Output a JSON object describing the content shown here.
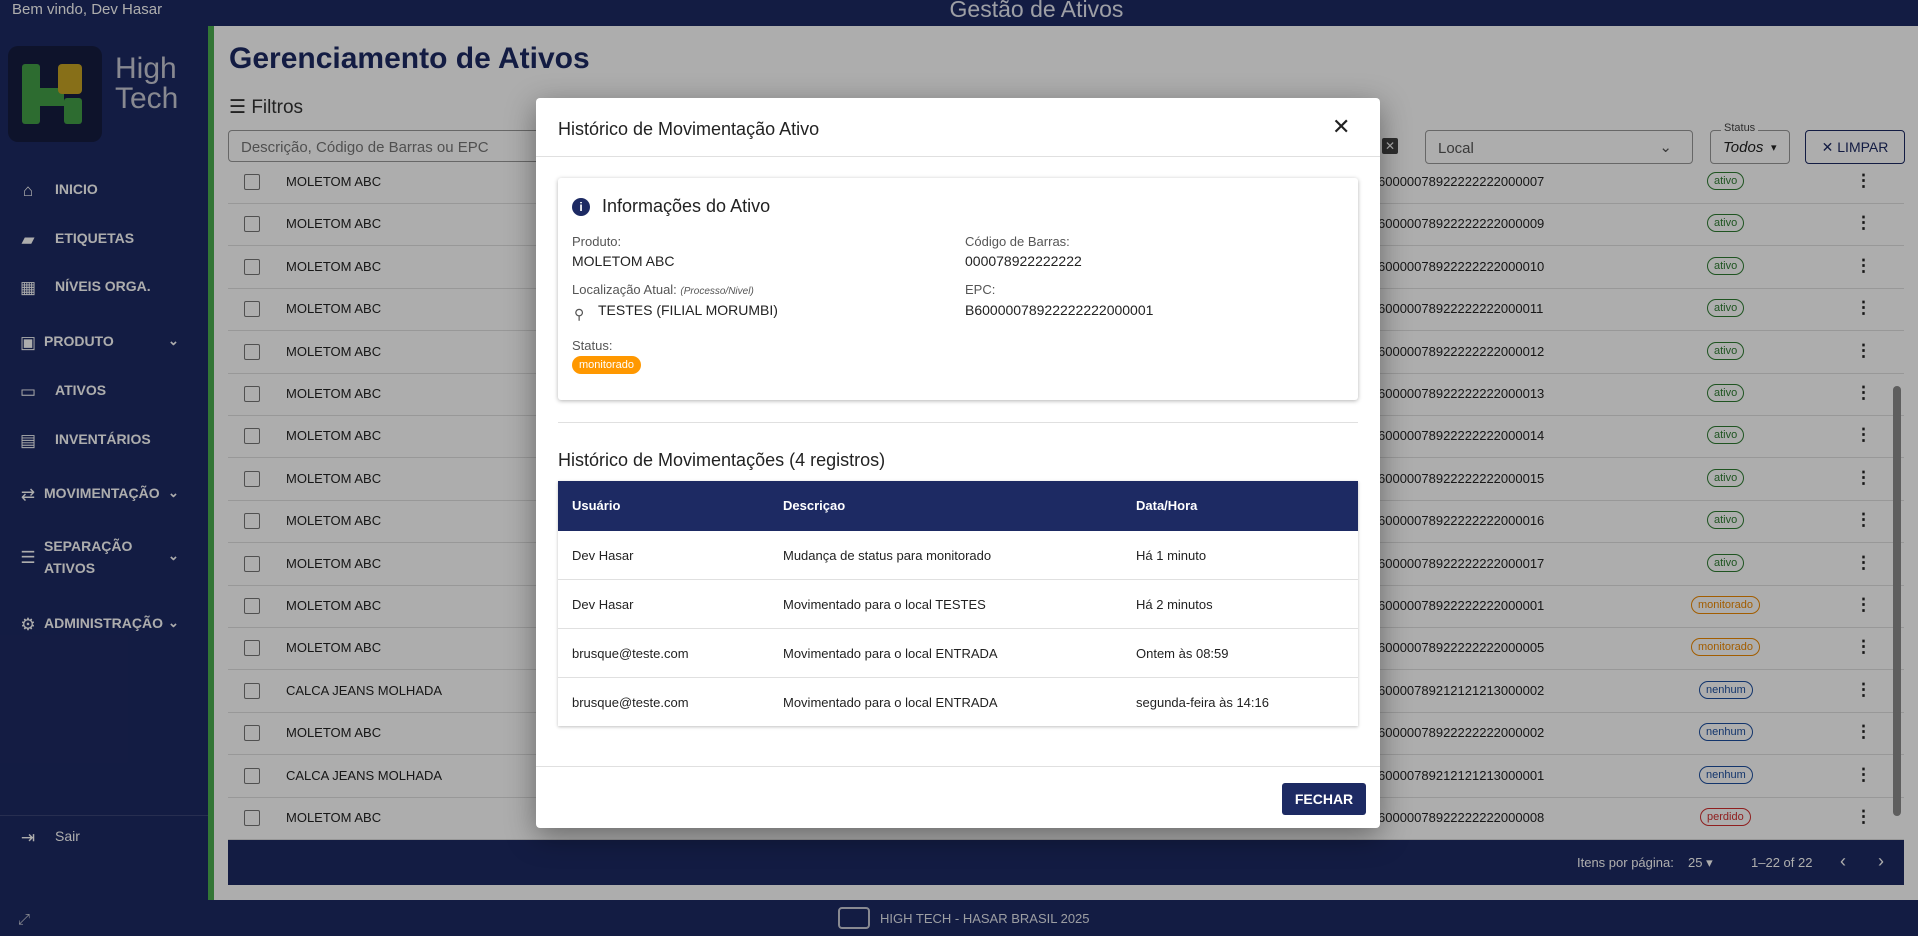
{
  "header": {
    "welcome": "Bem vindo, Dev Hasar",
    "app_title": "Gestão de Ativos"
  },
  "sidebar": {
    "logo_text_1": "High",
    "logo_text_2": "Tech",
    "items": [
      {
        "label": "INICIO",
        "icon": "home-icon"
      },
      {
        "label": "ETIQUETAS",
        "icon": "label-icon"
      },
      {
        "label": "NÍVEIS ORGA.",
        "icon": "building-icon"
      },
      {
        "label": "PRODUTO",
        "icon": "bag-icon"
      },
      {
        "label": "ATIVOS",
        "icon": "laptop-icon"
      },
      {
        "label": "INVENTÁRIOS",
        "icon": "archive-icon"
      },
      {
        "label": "MOVIMENTAÇÃO",
        "icon": "swap-icon"
      },
      {
        "label_1": "SEPARAÇÃO",
        "label_2": "ATIVOS",
        "icon": "checklist-icon"
      },
      {
        "label": "ADMINISTRAÇÃO",
        "icon": "gear-icon"
      }
    ],
    "logout": "Sair"
  },
  "main": {
    "title": "Gerenciamento de Ativos",
    "filters_label": "Filtros",
    "search_placeholder": "Descrição, Código de Barras ou EPC",
    "local_placeholder": "Local",
    "status_label": "Status",
    "status_value": "Todos",
    "clear_label": "LIMPAR",
    "rows": [
      {
        "product": "MOLETOM ABC",
        "epc": "60000078922222222000007",
        "status": "ativo"
      },
      {
        "product": "MOLETOM ABC",
        "epc": "60000078922222222000009",
        "status": "ativo"
      },
      {
        "product": "MOLETOM ABC",
        "epc": "60000078922222222000010",
        "status": "ativo"
      },
      {
        "product": "MOLETOM ABC",
        "epc": "60000078922222222000011",
        "status": "ativo"
      },
      {
        "product": "MOLETOM ABC",
        "epc": "60000078922222222000012",
        "status": "ativo"
      },
      {
        "product": "MOLETOM ABC",
        "epc": "60000078922222222000013",
        "status": "ativo"
      },
      {
        "product": "MOLETOM ABC",
        "epc": "60000078922222222000014",
        "status": "ativo"
      },
      {
        "product": "MOLETOM ABC",
        "epc": "60000078922222222000015",
        "status": "ativo"
      },
      {
        "product": "MOLETOM ABC",
        "epc": "60000078922222222000016",
        "status": "ativo"
      },
      {
        "product": "MOLETOM ABC",
        "epc": "60000078922222222000017",
        "status": "ativo"
      },
      {
        "product": "MOLETOM ABC",
        "epc": "60000078922222222000001",
        "status": "monitorado"
      },
      {
        "product": "MOLETOM ABC",
        "epc": "60000078922222222000005",
        "status": "monitorado"
      },
      {
        "product": "CALCA JEANS MOLHADA",
        "epc": "60000789212121213000002",
        "status": "nenhum"
      },
      {
        "product": "MOLETOM ABC",
        "epc": "60000078922222222000002",
        "status": "nenhum"
      },
      {
        "product": "CALCA JEANS MOLHADA",
        "epc": "60000789212121213000001",
        "status": "nenhum"
      },
      {
        "product": "MOLETOM ABC",
        "epc": "60000078922222222000008",
        "status": "perdido"
      }
    ],
    "paginator": {
      "items_per_page_label": "Itens por página:",
      "page_size": "25",
      "range": "1–22 of 22"
    }
  },
  "footer": {
    "text": "HIGH TECH - HASAR BRASIL 2025"
  },
  "dialog": {
    "title": "Histórico de Movimentação Ativo",
    "info_title": "Informações do Ativo",
    "product_label": "Produto:",
    "product_value": "MOLETOM ABC",
    "barcode_label": "Código de Barras:",
    "barcode_value": "000078922222222",
    "location_label": "Localização Atual:",
    "location_sub": "(Processo/Nivel)",
    "location_value": "TESTES (FILIAL MORUMBI)",
    "epc_label": "EPC:",
    "epc_value": "B60000078922222222000001",
    "status_label": "Status:",
    "status_value": "monitorado",
    "history_title": "Histórico de Movimentações (4 registros)",
    "columns": [
      "Usuário",
      "Descriçao",
      "Data/Hora"
    ],
    "history": [
      {
        "user": "Dev Hasar",
        "desc": "Mudança de status para monitorado",
        "date": "Há 1 minuto"
      },
      {
        "user": "Dev Hasar",
        "desc": "Movimentado para o local TESTES",
        "date": "Há 2 minutos"
      },
      {
        "user": "brusque@teste.com",
        "desc": "Movimentado para o local ENTRADA",
        "date": "Ontem às 08:59"
      },
      {
        "user": "brusque@teste.com",
        "desc": "Movimentado para o local ENTRADA",
        "date": "segunda-feira às 14:16"
      }
    ],
    "close_button": "FECHAR"
  },
  "colors": {
    "primary": "#1d2a63",
    "accent_green": "#4caf50",
    "monitorado": "#ff9800"
  }
}
